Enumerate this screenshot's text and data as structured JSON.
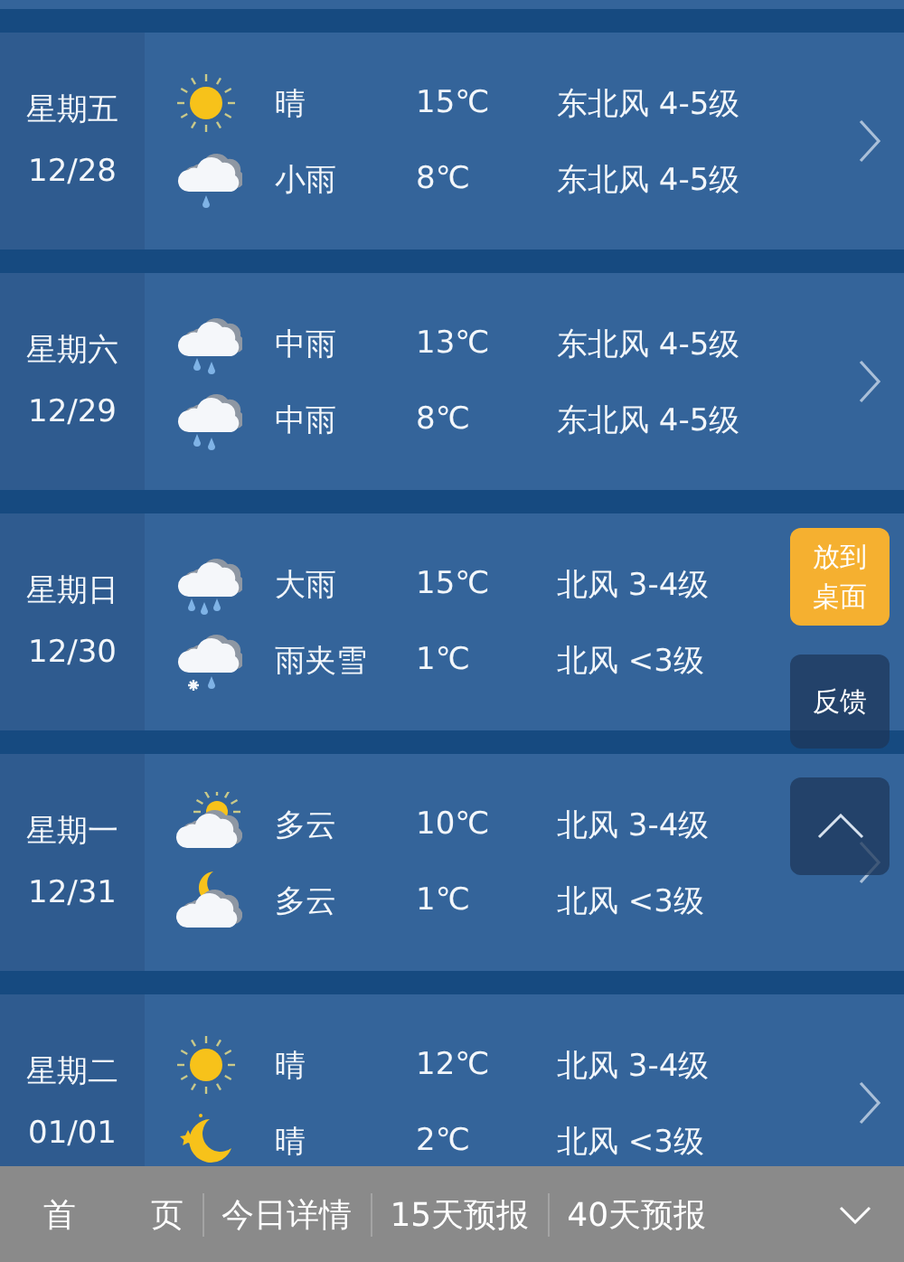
{
  "days": [
    {
      "weekday": "星期五",
      "date": "12/28",
      "lines": [
        {
          "kind": "sunny",
          "condition": "晴",
          "temp": "15℃",
          "wind": "东北风 4-5级"
        },
        {
          "kind": "light_rain",
          "condition": "小雨",
          "temp": "8℃",
          "wind": "东北风 4-5级"
        }
      ]
    },
    {
      "weekday": "星期六",
      "date": "12/29",
      "lines": [
        {
          "kind": "rain",
          "condition": "中雨",
          "temp": "13℃",
          "wind": "东北风 4-5级"
        },
        {
          "kind": "rain",
          "condition": "中雨",
          "temp": "8℃",
          "wind": "东北风 4-5级"
        }
      ]
    },
    {
      "weekday": "星期日",
      "date": "12/30",
      "chevron": false,
      "lines": [
        {
          "kind": "heavy_rain",
          "condition": "大雨",
          "temp": "15℃",
          "wind": "北风 3-4级"
        },
        {
          "kind": "sleet",
          "condition": "雨夹雪",
          "temp": "1℃",
          "wind": "北风 <3级"
        }
      ]
    },
    {
      "weekday": "星期一",
      "date": "12/31",
      "lines": [
        {
          "kind": "cloudy_day",
          "condition": "多云",
          "temp": "10℃",
          "wind": "北风 3-4级"
        },
        {
          "kind": "cloudy_night",
          "condition": "多云",
          "temp": "1℃",
          "wind": "北风 <3级"
        }
      ]
    },
    {
      "weekday": "星期二",
      "date": "01/01",
      "lines": [
        {
          "kind": "sunny",
          "condition": "晴",
          "temp": "12℃",
          "wind": "北风 3-4级"
        },
        {
          "kind": "clear_night",
          "condition": "晴",
          "temp": "2℃",
          "wind": "北风 <3级"
        }
      ]
    }
  ],
  "floating": {
    "pin": "放到桌面",
    "feedback": "反馈"
  },
  "nav": [
    "首 页",
    "今日详情",
    "15天预报",
    "40天预报"
  ]
}
